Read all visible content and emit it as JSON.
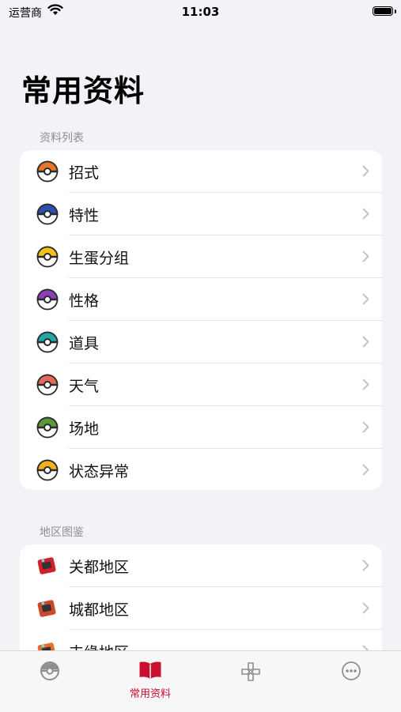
{
  "status": {
    "carrier": "运营商",
    "time": "11:03"
  },
  "title": "常用资料",
  "sections": [
    {
      "header": "资料列表",
      "items": [
        {
          "label": "招式",
          "icon": "pokeball-orange-icon",
          "color": "#e8752a"
        },
        {
          "label": "特性",
          "icon": "great-ball-icon",
          "color": "#2d4fb0"
        },
        {
          "label": "生蛋分组",
          "icon": "ultra-ball-icon",
          "color": "#f2c21c"
        },
        {
          "label": "性格",
          "icon": "master-ball-icon",
          "color": "#8a3fb8"
        },
        {
          "label": "道具",
          "icon": "net-ball-icon",
          "color": "#22a6a8"
        },
        {
          "label": "天气",
          "icon": "dive-ball-icon",
          "color": "#e36a5a"
        },
        {
          "label": "场地",
          "icon": "nest-ball-icon",
          "color": "#5a9a3a"
        },
        {
          "label": "状态异常",
          "icon": "quick-ball-icon",
          "color": "#f0b020"
        }
      ]
    },
    {
      "header": "地区图鉴",
      "items": [
        {
          "label": "关都地区",
          "icon": "pokedex-red-icon",
          "color": "#d0202a"
        },
        {
          "label": "城都地区",
          "icon": "pokegear-icon",
          "color": "#c84a2a"
        },
        {
          "label": "丰缘地区",
          "icon": "pokenav-icon",
          "color": "#e0702a"
        }
      ]
    }
  ],
  "tabs": [
    {
      "id": "pokedex",
      "icon": "pokeball-tab-icon",
      "label": ""
    },
    {
      "id": "reference",
      "icon": "book-icon",
      "label": "常用资料",
      "active": true
    },
    {
      "id": "games",
      "icon": "gamepad-icon",
      "label": ""
    },
    {
      "id": "more",
      "icon": "ellipsis-circle-icon",
      "label": ""
    }
  ],
  "accent_color": "#c8102e"
}
